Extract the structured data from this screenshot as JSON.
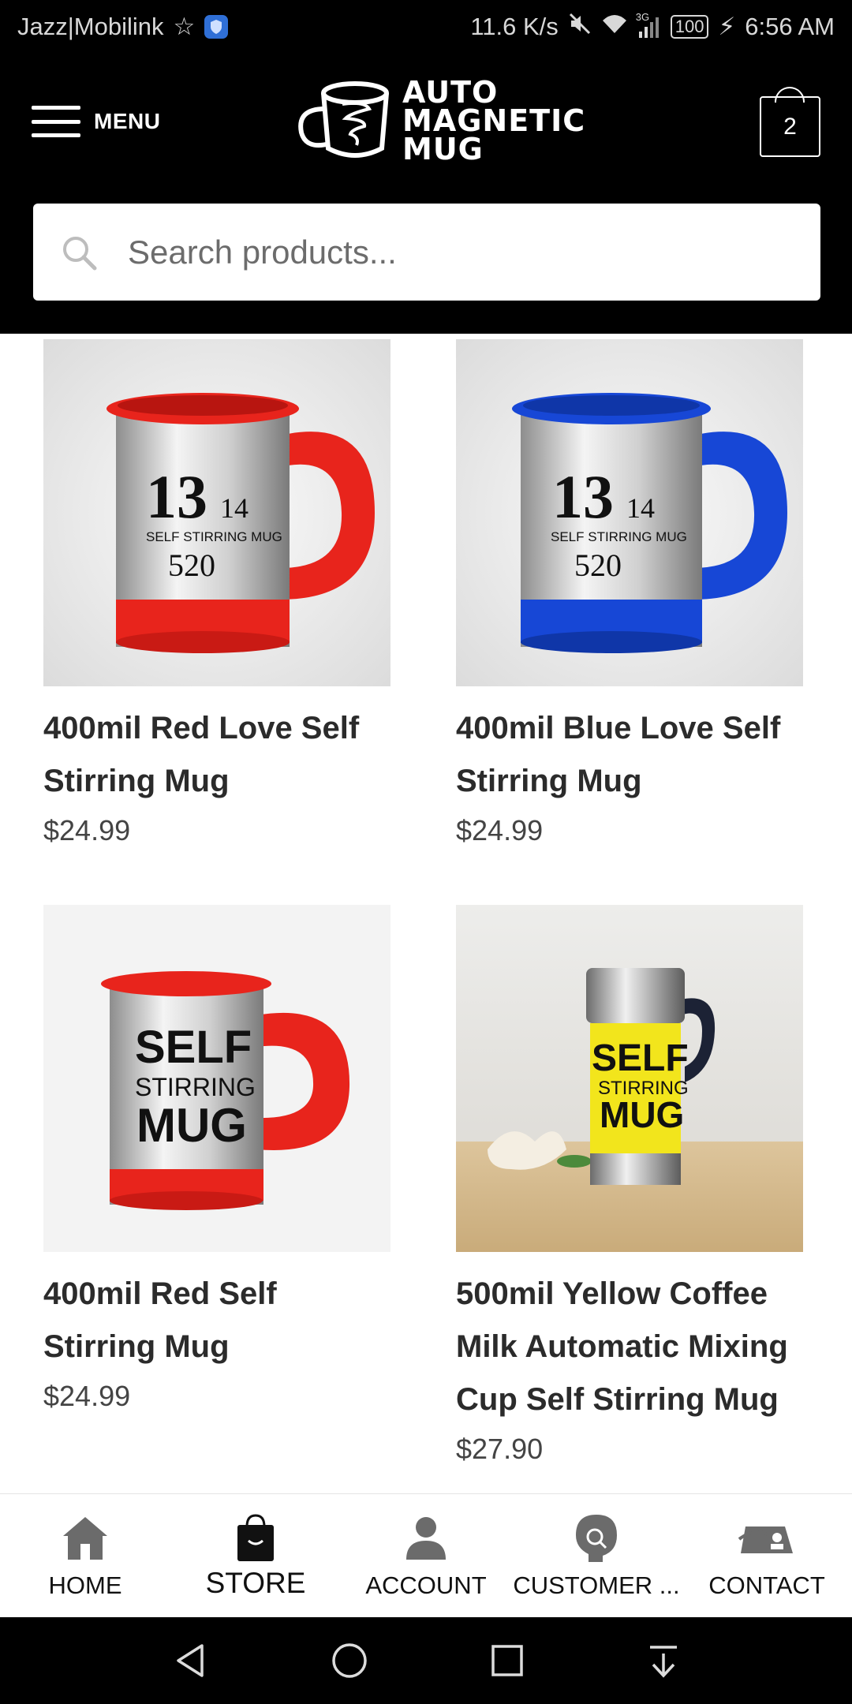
{
  "status_bar": {
    "carrier": "Jazz|Mobilink",
    "speed": "11.6 K/s",
    "network": "3G",
    "battery": "100",
    "time": "6:56 AM"
  },
  "header": {
    "menu_label": "MENU",
    "logo_lines": [
      "AUTO",
      "MAGNETIC",
      "MUG"
    ],
    "cart_count": "2",
    "search_placeholder": "Search products..."
  },
  "products": [
    {
      "title_lines": [
        "400mil Red Love Self",
        "Stirring Mug"
      ],
      "price": "$24.99",
      "image": {
        "color": "#e8241c",
        "print": [
          "13",
          "14",
          "SELF STIRRING MUG",
          "520"
        ]
      }
    },
    {
      "title_lines": [
        "400mil Blue Love Self",
        "Stirring Mug"
      ],
      "price": "$24.99",
      "image": {
        "color": "#1747d6",
        "print": [
          "13",
          "14",
          "SELF STIRRING MUG",
          "520"
        ]
      }
    },
    {
      "title_lines": [
        "400mil Red Self",
        "Stirring Mug"
      ],
      "price": "$24.99",
      "image": {
        "color": "#e8241c",
        "print": [
          "SELF",
          "STIRRING",
          "MUG"
        ]
      }
    },
    {
      "title_lines": [
        "500mil Yellow Coffee",
        "Milk Automatic Mixing",
        "Cup Self Stirring Mug"
      ],
      "price": "$27.90",
      "image": {
        "color": "#f2e51c",
        "print": [
          "SELF",
          "STIRRING",
          "MUG"
        ]
      }
    }
  ],
  "bottom_nav": [
    {
      "label": "HOME",
      "icon": "home-icon"
    },
    {
      "label": "STORE",
      "icon": "shopping-bag-icon",
      "active": true
    },
    {
      "label": "ACCOUNT",
      "icon": "user-icon"
    },
    {
      "label": "CUSTOMER ...",
      "icon": "customer-support-icon"
    },
    {
      "label": "CONTACT",
      "icon": "contact-card-icon"
    }
  ],
  "colors": {
    "header_bg": "#000000",
    "text": "#2b2b2b",
    "nav_icon": "#6b6b6b"
  }
}
